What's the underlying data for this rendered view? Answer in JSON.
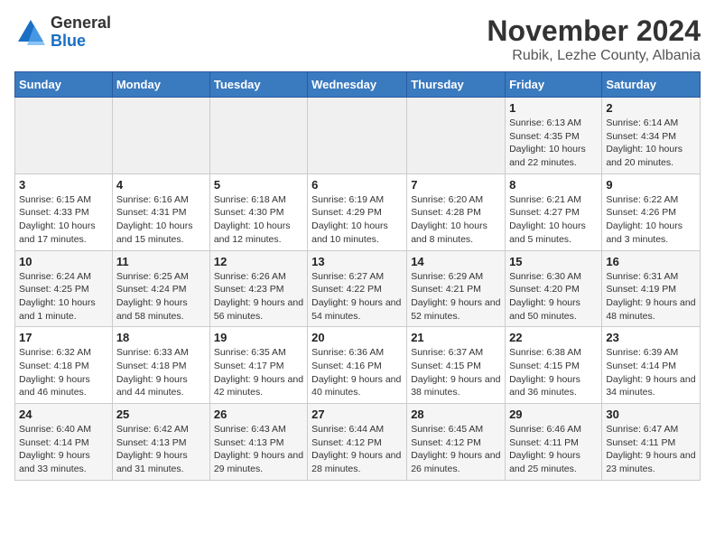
{
  "logo": {
    "general": "General",
    "blue": "Blue"
  },
  "title": "November 2024",
  "location": "Rubik, Lezhe County, Albania",
  "weekdays": [
    "Sunday",
    "Monday",
    "Tuesday",
    "Wednesday",
    "Thursday",
    "Friday",
    "Saturday"
  ],
  "weeks": [
    [
      {
        "day": "",
        "info": ""
      },
      {
        "day": "",
        "info": ""
      },
      {
        "day": "",
        "info": ""
      },
      {
        "day": "",
        "info": ""
      },
      {
        "day": "",
        "info": ""
      },
      {
        "day": "1",
        "info": "Sunrise: 6:13 AM\nSunset: 4:35 PM\nDaylight: 10 hours and 22 minutes."
      },
      {
        "day": "2",
        "info": "Sunrise: 6:14 AM\nSunset: 4:34 PM\nDaylight: 10 hours and 20 minutes."
      }
    ],
    [
      {
        "day": "3",
        "info": "Sunrise: 6:15 AM\nSunset: 4:33 PM\nDaylight: 10 hours and 17 minutes."
      },
      {
        "day": "4",
        "info": "Sunrise: 6:16 AM\nSunset: 4:31 PM\nDaylight: 10 hours and 15 minutes."
      },
      {
        "day": "5",
        "info": "Sunrise: 6:18 AM\nSunset: 4:30 PM\nDaylight: 10 hours and 12 minutes."
      },
      {
        "day": "6",
        "info": "Sunrise: 6:19 AM\nSunset: 4:29 PM\nDaylight: 10 hours and 10 minutes."
      },
      {
        "day": "7",
        "info": "Sunrise: 6:20 AM\nSunset: 4:28 PM\nDaylight: 10 hours and 8 minutes."
      },
      {
        "day": "8",
        "info": "Sunrise: 6:21 AM\nSunset: 4:27 PM\nDaylight: 10 hours and 5 minutes."
      },
      {
        "day": "9",
        "info": "Sunrise: 6:22 AM\nSunset: 4:26 PM\nDaylight: 10 hours and 3 minutes."
      }
    ],
    [
      {
        "day": "10",
        "info": "Sunrise: 6:24 AM\nSunset: 4:25 PM\nDaylight: 10 hours and 1 minute."
      },
      {
        "day": "11",
        "info": "Sunrise: 6:25 AM\nSunset: 4:24 PM\nDaylight: 9 hours and 58 minutes."
      },
      {
        "day": "12",
        "info": "Sunrise: 6:26 AM\nSunset: 4:23 PM\nDaylight: 9 hours and 56 minutes."
      },
      {
        "day": "13",
        "info": "Sunrise: 6:27 AM\nSunset: 4:22 PM\nDaylight: 9 hours and 54 minutes."
      },
      {
        "day": "14",
        "info": "Sunrise: 6:29 AM\nSunset: 4:21 PM\nDaylight: 9 hours and 52 minutes."
      },
      {
        "day": "15",
        "info": "Sunrise: 6:30 AM\nSunset: 4:20 PM\nDaylight: 9 hours and 50 minutes."
      },
      {
        "day": "16",
        "info": "Sunrise: 6:31 AM\nSunset: 4:19 PM\nDaylight: 9 hours and 48 minutes."
      }
    ],
    [
      {
        "day": "17",
        "info": "Sunrise: 6:32 AM\nSunset: 4:18 PM\nDaylight: 9 hours and 46 minutes."
      },
      {
        "day": "18",
        "info": "Sunrise: 6:33 AM\nSunset: 4:18 PM\nDaylight: 9 hours and 44 minutes."
      },
      {
        "day": "19",
        "info": "Sunrise: 6:35 AM\nSunset: 4:17 PM\nDaylight: 9 hours and 42 minutes."
      },
      {
        "day": "20",
        "info": "Sunrise: 6:36 AM\nSunset: 4:16 PM\nDaylight: 9 hours and 40 minutes."
      },
      {
        "day": "21",
        "info": "Sunrise: 6:37 AM\nSunset: 4:15 PM\nDaylight: 9 hours and 38 minutes."
      },
      {
        "day": "22",
        "info": "Sunrise: 6:38 AM\nSunset: 4:15 PM\nDaylight: 9 hours and 36 minutes."
      },
      {
        "day": "23",
        "info": "Sunrise: 6:39 AM\nSunset: 4:14 PM\nDaylight: 9 hours and 34 minutes."
      }
    ],
    [
      {
        "day": "24",
        "info": "Sunrise: 6:40 AM\nSunset: 4:14 PM\nDaylight: 9 hours and 33 minutes."
      },
      {
        "day": "25",
        "info": "Sunrise: 6:42 AM\nSunset: 4:13 PM\nDaylight: 9 hours and 31 minutes."
      },
      {
        "day": "26",
        "info": "Sunrise: 6:43 AM\nSunset: 4:13 PM\nDaylight: 9 hours and 29 minutes."
      },
      {
        "day": "27",
        "info": "Sunrise: 6:44 AM\nSunset: 4:12 PM\nDaylight: 9 hours and 28 minutes."
      },
      {
        "day": "28",
        "info": "Sunrise: 6:45 AM\nSunset: 4:12 PM\nDaylight: 9 hours and 26 minutes."
      },
      {
        "day": "29",
        "info": "Sunrise: 6:46 AM\nSunset: 4:11 PM\nDaylight: 9 hours and 25 minutes."
      },
      {
        "day": "30",
        "info": "Sunrise: 6:47 AM\nSunset: 4:11 PM\nDaylight: 9 hours and 23 minutes."
      }
    ]
  ]
}
